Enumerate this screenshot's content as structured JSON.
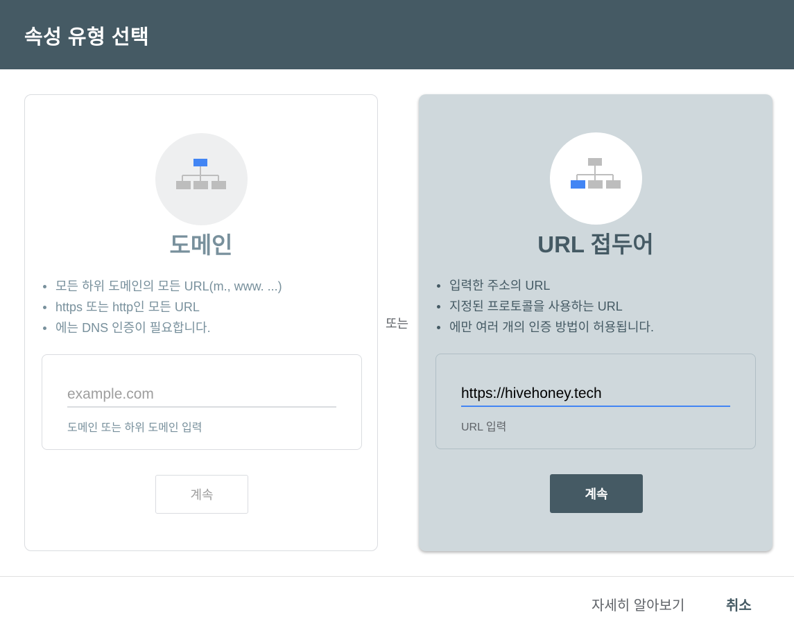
{
  "dialog": {
    "title": "속성 유형 선택"
  },
  "domain": {
    "title": "도메인",
    "features": [
      "모든 하위 도메인의 모든 URL(m., www. ...)",
      "https 또는 http인 모든 URL",
      "에는 DNS 인증이 필요합니다."
    ],
    "input_placeholder": "example.com",
    "input_value": "",
    "helper": "도메인 또는 하위 도메인 입력",
    "button": "계속"
  },
  "or_label": "또는",
  "url_prefix": {
    "title": "URL 접두어",
    "features": [
      "입력한 주소의 URL",
      "지정된 프로토콜을 사용하는 URL",
      "에만 여러 개의 인증 방법이 허용됩니다."
    ],
    "input_placeholder": "",
    "input_value": "https://hivehoney.tech",
    "helper": "URL 입력",
    "button": "계속"
  },
  "footer": {
    "learn_more": "자세히 알아보기",
    "cancel": "취소"
  },
  "colors": {
    "header": "#455a64",
    "selected_card": "#cfd8dc",
    "accent": "#4285f4",
    "icon_gray": "#bdbdbd"
  },
  "icons": {
    "domain": "sitemap-icon-root-highlighted",
    "url_prefix": "sitemap-icon-leaf-highlighted"
  }
}
